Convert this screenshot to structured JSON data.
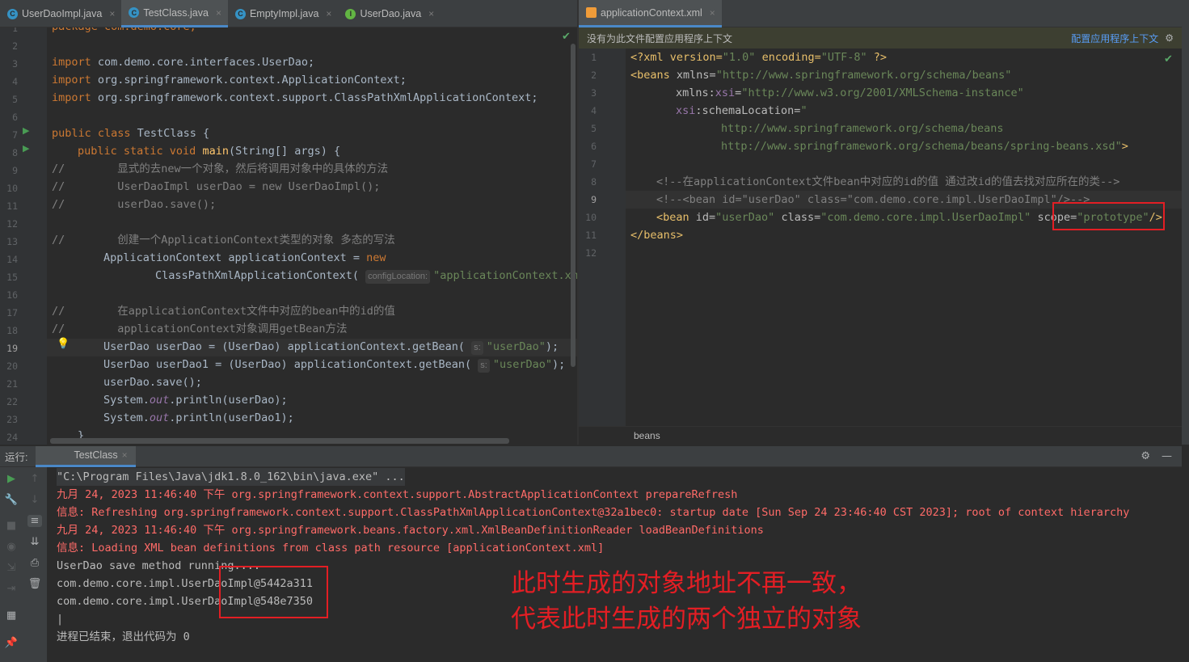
{
  "left_tabs": [
    {
      "label": "UserDaoImpl.java",
      "icon": "class-icon",
      "active": false
    },
    {
      "label": "TestClass.java",
      "icon": "class-icon",
      "active": true
    },
    {
      "label": "EmptyImpl.java",
      "icon": "class-icon",
      "active": false
    },
    {
      "label": "UserDao.java",
      "icon": "interface-icon",
      "active": false
    }
  ],
  "right_tabs": [
    {
      "label": "applicationContext.xml",
      "icon": "xml-icon",
      "active": true
    }
  ],
  "close_glyph": "×",
  "left_editor": {
    "line_numbers": [
      "1",
      "2",
      "3",
      "4",
      "5",
      "6",
      "7",
      "8",
      "9",
      "10",
      "11",
      "12",
      "13",
      "14",
      "15",
      "16",
      "17",
      "18",
      "19",
      "20",
      "21",
      "22",
      "23",
      "24"
    ],
    "current_line": "19",
    "code": {
      "l1": "package com.demo.core;",
      "l3_kw": "import",
      "l3_rest": " com.demo.core.interfaces.UserDao;",
      "l4_kw": "import",
      "l4_rest": " org.springframework.context.ApplicationContext;",
      "l5_kw": "import",
      "l5_rest": " org.springframework.context.support.ClassPathXmlApplicationContext;",
      "l7_kw": "public class",
      "l7_rest": " TestClass {",
      "l8_kw": "public static void",
      "l8_fn": "main",
      "l8_rest": "(String[] args) {",
      "l9_cmt": "//        显式的去new一个对象，然后将调用对象中的具体的方法",
      "l10_cmt": "//        UserDaoImpl userDao = new UserDaoImpl();",
      "l11_cmt": "//        userDao.save();",
      "l13_cmt": "//        创建一个ApplicationContext类型的对象 多态的写法",
      "l14_rest": "ApplicationContext applicationContext = ",
      "l14_kw": "new",
      "l15_rest": "ClassPathXmlApplicationContext(",
      "l15_hint": "configLocation:",
      "l15_str": "\"applicationContext.xml\");",
      "l17_cmt": "//        在applicationContext文件中对应的bean中的id的值",
      "l18_cmt": "//        applicationContext对象调用getBean方法",
      "l19_rest": "UserDao userDao = (UserDao) applicationContext.getBean(",
      "l19_hint": "s:",
      "l19_str": "\"userDao\"",
      "l19_end": ");",
      "l20_rest": "UserDao userDao1 = (UserDao) applicationContext.getBean(",
      "l20_hint": "s:",
      "l20_str": "\"userDao\"",
      "l20_end": ");",
      "l21": "userDao.save();",
      "l22_a": "System.",
      "l22_fld": "out",
      "l22_b": ".println(userDao);",
      "l23_a": "System.",
      "l23_fld": "out",
      "l23_b": ".println(userDao1);",
      "l24": "}"
    }
  },
  "right_editor": {
    "notice": "没有为此文件配置应用程序上下文",
    "notice_link": "配置应用程序上下文",
    "line_numbers": [
      "1",
      "2",
      "3",
      "4",
      "5",
      "6",
      "7",
      "8",
      "9",
      "10",
      "11",
      "12"
    ],
    "current_line": "9",
    "code": {
      "x1_a": "<?xml version=",
      "x1_v1": "\"1.0\"",
      "x1_b": " encoding=",
      "x1_v2": "\"UTF-8\"",
      "x1_c": " ?>",
      "x2_tag": "<beans",
      "x2_attr": " xmlns=",
      "x2_val": "\"http://www.springframework.org/schema/beans\"",
      "x3_attr": "xmlns:",
      "x3_ns": "xsi",
      "x3_eq": "=",
      "x3_val": "\"http://www.w3.org/2001/XMLSchema-instance\"",
      "x4_ns": "xsi",
      "x4_attr": ":schemaLocation=",
      "x4_val": "\"",
      "x5_val": "http://www.springframework.org/schema/beans",
      "x6_val": "http://www.springframework.org/schema/beans/spring-beans.xsd\"",
      "x6_end": ">",
      "x8_cmt": "<!--在applicationContext文件bean中对应的id的值 通过改id的值去找对应所在的类-->",
      "x9_cmt": "<!--<bean id=\"userDao\" class=\"com.demo.core.impl.UserDaoImpl\"/>-->",
      "x10_tag": "<bean",
      "x10_a1": " id=",
      "x10_v1": "\"userDao\"",
      "x10_a2": " class=",
      "x10_v2": "\"com.demo.core.impl.UserDaoImpl\"",
      "x10_a3": " scope=",
      "x10_v3": "\"prototype\"",
      "x10_end": "/>",
      "x11_tag": "</beans>"
    },
    "breadcrumb": "beans"
  },
  "run_panel": {
    "title": "运行:",
    "tab": "TestClass",
    "console": [
      {
        "text": "\"C:\\Program Files\\Java\\jdk1.8.0_162\\bin\\java.exe\" ...",
        "style": "cmd"
      },
      {
        "text": "九月 24, 2023 11:46:40 下午 org.springframework.context.support.AbstractApplicationContext prepareRefresh",
        "style": "red"
      },
      {
        "text": "信息: Refreshing org.springframework.context.support.ClassPathXmlApplicationContext@32a1bec0: startup date [Sun Sep 24 23:46:40 CST 2023]; root of context hierarchy",
        "style": "red"
      },
      {
        "text": "九月 24, 2023 11:46:40 下午 org.springframework.beans.factory.xml.XmlBeanDefinitionReader loadBeanDefinitions",
        "style": "red"
      },
      {
        "text": "信息: Loading XML bean definitions from class path resource [applicationContext.xml]",
        "style": "red"
      },
      {
        "text": "UserDao save method running....",
        "style": "gray"
      },
      {
        "text": "com.demo.core.impl.UserDaoImpl@5442a311",
        "style": "gray"
      },
      {
        "text": "com.demo.core.impl.UserDaoImpl@548e7350",
        "style": "gray"
      },
      {
        "text": "|",
        "style": "gray"
      },
      {
        "text": "进程已结束，退出代码为 0",
        "style": "gray"
      }
    ]
  },
  "annotation": {
    "line1": "此时生成的对象地址不再一致，",
    "line2": "代表此时生成的两个独立的对象",
    "color": "#e31e24"
  },
  "colors": {
    "keyword": "#cc7832",
    "string": "#6a8759",
    "comment": "#808080",
    "error_text": "#ff6b68",
    "highlight_box": "#e31e24"
  }
}
